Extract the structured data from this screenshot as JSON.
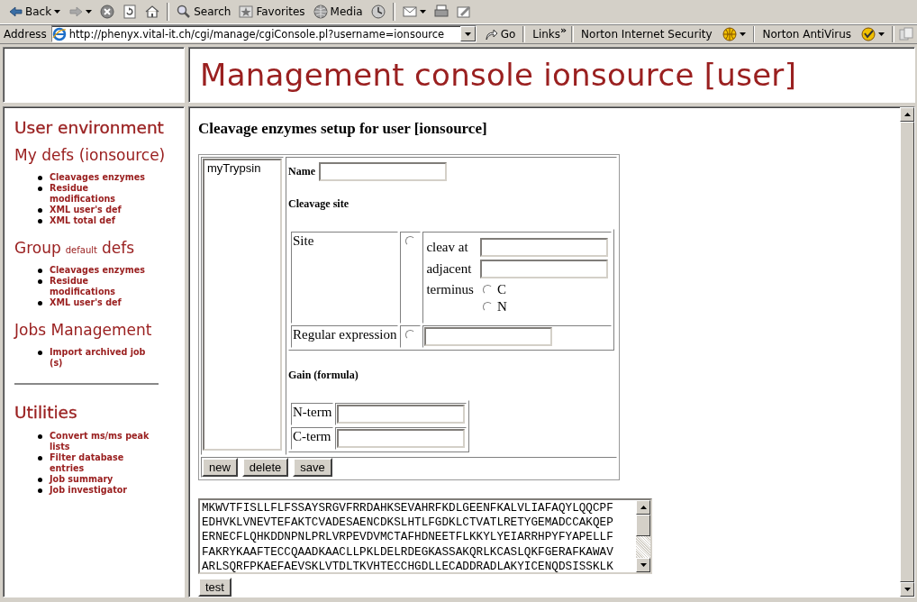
{
  "toolbar": {
    "buttons": [
      {
        "label": "Back",
        "kind": "back"
      },
      {
        "kind": "forward"
      },
      {
        "kind": "stop"
      },
      {
        "kind": "refresh"
      },
      {
        "kind": "home"
      },
      {
        "label": "Search",
        "kind": "search"
      },
      {
        "label": "Favorites",
        "kind": "favorites"
      },
      {
        "label": "Media",
        "kind": "media"
      },
      {
        "kind": "history"
      },
      {
        "kind": "mail"
      },
      {
        "kind": "print"
      },
      {
        "kind": "edit"
      }
    ]
  },
  "address_bar": {
    "label": "Address",
    "url": "http://phenyx.vital-it.ch/cgi/manage/cgiConsole.pl?username=ionsource",
    "go": "Go",
    "links": "Links",
    "links_chevron": "»",
    "addons": [
      "Norton Internet Security",
      "Norton AntiVirus"
    ]
  },
  "header": {
    "title": "Management console ionsource [user]"
  },
  "sidebar": {
    "sections": [
      {
        "kind": "heading",
        "title_parts": [
          "User environment"
        ],
        "divider_before": false
      },
      {
        "kind": "subheading",
        "title_parts": [
          "My defs (ionsource)"
        ],
        "divider_before": false,
        "items": [
          "Cleavages enzymes",
          "Residue modifications",
          "XML user's def",
          "XML total def"
        ]
      },
      {
        "kind": "subheading",
        "title_parts": [
          "Group",
          "default",
          "defs"
        ],
        "divider_before": false,
        "items": [
          "Cleavages enzymes",
          "Residue modifications",
          "XML user's def"
        ]
      },
      {
        "kind": "subheading",
        "title_parts": [
          "Jobs Management"
        ],
        "divider_before": false,
        "items": [
          "Import archived job (s)"
        ]
      },
      {
        "kind": "heading",
        "title_parts": [
          "Utilities"
        ],
        "divider_before": true,
        "items": [
          "Convert ms/ms peak lists",
          "Filter database entries",
          "Job summary",
          "Job investigator"
        ]
      }
    ]
  },
  "content": {
    "heading": "Cleavage enzymes setup for user [ionsource]",
    "enzymes": [
      {
        "label": "myTrypsin",
        "selected": false
      }
    ],
    "form": {
      "name_label": "Name",
      "cleavage_heading": "Cleavage site",
      "site": {
        "label": "Site",
        "selected": false,
        "cleav_at": "cleav at",
        "adjacent": "adjacent",
        "terminus": "terminus",
        "terminus_options": [
          {
            "label": "C",
            "selected": false
          },
          {
            "label": "N",
            "selected": false
          }
        ]
      },
      "regex": {
        "label": "Regular expression",
        "selected": false
      },
      "gain_heading": "Gain (formula)",
      "gain_rows": [
        "N-term",
        "C-term"
      ]
    },
    "buttons": [
      "new",
      "delete",
      "save"
    ],
    "sequence_lines": [
      "MKWVTFISLLFLFSSAYSRGVFRRDAHKSEVAHRFKDLGEENFKALVLIAFAQYLQQCPF",
      "EDHVKLVNEVTEFAKTCVADESAENCDKSLHTLFGDKLCTVATLRETYGEMADCCAKQEP",
      "ERNECFLQHKDDNPNLPRLVRPEVDVMCTAFHDNEETFLKKYLYEIARRHPYFYAPELLF",
      "FAKRYKAAFTECCQAADKAACLLPKLDELRDEGKASSAKQRLKCASLQKFGERAFKAWAV",
      "ARLSQRFPKAEFAEVSKLVTDLTKVHTECCHGDLLECADDRADLAKYICENQDSISSKLK"
    ],
    "test_button": "test"
  }
}
